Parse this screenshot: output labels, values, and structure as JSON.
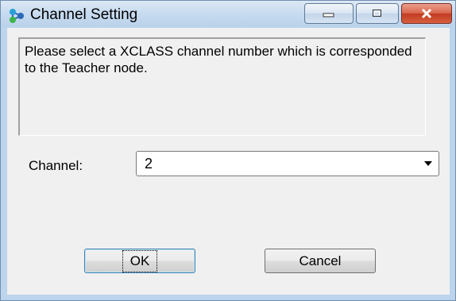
{
  "window": {
    "title": "Channel Setting",
    "icon": "network-nodes-icon",
    "controls": {
      "minimize": "minimize-icon",
      "maximize": "maximize-icon",
      "close": "close-icon"
    }
  },
  "message": "Please select a XCLASS channel number which is corresponded to the Teacher node.",
  "channel": {
    "label": "Channel:",
    "selected": "2"
  },
  "buttons": {
    "ok": "OK",
    "cancel": "Cancel"
  },
  "colors": {
    "close_button": "#c23a20",
    "focus_border": "#3c7fb1"
  }
}
